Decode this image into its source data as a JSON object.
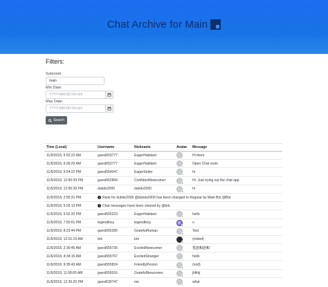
{
  "header": {
    "title": "Chat Archive for Main"
  },
  "filters": {
    "heading": "Filters:",
    "subreddit_label": "Subroom:",
    "subreddit_value": "main",
    "min_date_label": "Min Date:",
    "min_date_placeholder": "YYYY-MM-DD hh:mm",
    "max_date_label": "Max Date:",
    "max_date_placeholder": "YYYY-MM-DD hh:mm",
    "search_label": "Search"
  },
  "table": {
    "columns": [
      "Time (Local)",
      "Username",
      "Nickname",
      "Avatar",
      "Message"
    ],
    "rows": [
      {
        "kind": "msg",
        "time": "11/5/2018, 5:52:22 AM",
        "username": "guest553777",
        "nickname": "EagerHabitant",
        "avatar": "default",
        "message": "Hi there"
      },
      {
        "kind": "msg",
        "time": "11/5/2018, 6:00:29 AM",
        "username": "guest553777",
        "nickname": "EagerHabitant",
        "avatar": "default",
        "message": "Open Chat room"
      },
      {
        "kind": "msg",
        "time": "11/5/2018, 5:54:22 PM",
        "username": "guest554047",
        "nickname": "EagerSetter",
        "avatar": "default",
        "message": "hi"
      },
      {
        "kind": "msg",
        "time": "11/5/2018, 12:50:39 PM",
        "username": "guest552894",
        "nickname": "ConfidentNewcomer",
        "avatar": "default",
        "message": "Hi. Just trying out the chat app"
      },
      {
        "kind": "msg",
        "time": "11/5/2018, 12:50:39 PM",
        "username": "dubdo2000",
        "nickname": "dubdo2000",
        "avatar": "default",
        "message": "hi"
      },
      {
        "kind": "sys",
        "time": "11/5/2018, 2:50:31 PM",
        "message": "Rank for dubdo2000 @dubdo2000 has been changed to Regular by Main Bot @Bot"
      },
      {
        "kind": "sys",
        "time": "11/5/2018, 5:03:13 PM",
        "message": "Chat messages have been cleared by @brk."
      },
      {
        "kind": "msg",
        "time": "11/5/2018, 5:52:20 PM",
        "username": "guest555223",
        "nickname": "EagerHabitant",
        "avatar": "default",
        "message": "hello"
      },
      {
        "kind": "msg",
        "time": "11/5/2018, 7:50:01 PM",
        "username": "legendfoxy",
        "nickname": "legendfoxy",
        "avatar": "purple",
        "message": "c-"
      },
      {
        "kind": "msg",
        "time": "11/5/2018, 8:23:44 PM",
        "username": "guest555395",
        "nickname": "GratefulHuman",
        "avatar": "default",
        "message": "Test"
      },
      {
        "kind": "msg",
        "time": "11/6/2018, 12:01:15 AM",
        "username": "brk",
        "nickname": "brk",
        "avatar": "dark",
        "message": "(rivited)"
      },
      {
        "kind": "msg",
        "time": "11/6/2018, 2:30:45 AM",
        "username": "guest555736",
        "nickname": "ExcitedNewcomer",
        "avatar": "default",
        "message": "花店和店和"
      },
      {
        "kind": "msg",
        "time": "11/6/2018, 4:34:15 AM",
        "username": "guest555767",
        "nickname": "ExcitedStranger",
        "avatar": "default",
        "message": "hello"
      },
      {
        "kind": "msg",
        "time": "11/6/2018, 9:35:43 AM",
        "username": "guest555824",
        "nickname": "FriendlyPerson",
        "avatar": "default",
        "message": "(nod)"
      },
      {
        "kind": "msg",
        "time": "11/6/2018, 11:58:05 AM",
        "username": "guest556016",
        "nickname": "GratefulNewcomer",
        "avatar": "default",
        "message": "jhfkkj"
      },
      {
        "kind": "msg",
        "time": "11/6/2018, 12:26:26 PM",
        "username": "guest530747",
        "nickname": "me",
        "avatar": "default",
        "message": "what"
      }
    ]
  },
  "icons": {
    "calendar": "calendar-icon",
    "search": "search-icon",
    "info": "info-icon"
  },
  "colors": {
    "hero_blue": "#1e6df0",
    "title_navy": "#0d2f6e",
    "button_gray": "#5a6268",
    "online_green": "#28a745"
  }
}
